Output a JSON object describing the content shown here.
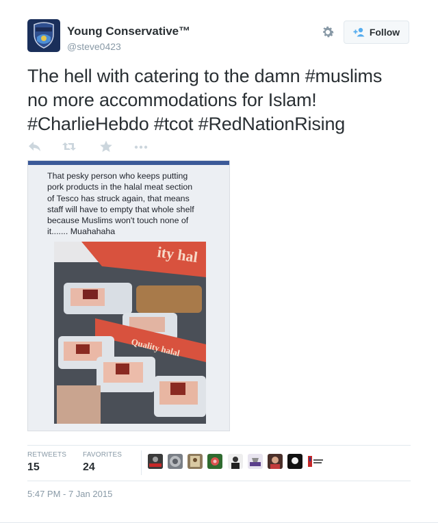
{
  "author": {
    "name": "Young Conservative™",
    "handle": "@steve0423",
    "avatar_badge_text": "POLICE DEPARTMENT"
  },
  "header": {
    "settings_icon": "gear-icon",
    "follow_label": "Follow",
    "follow_icon": "add-user-icon"
  },
  "tweet": {
    "lines": [
      "The hell with catering to the damn #muslims",
      "no more accommodations for Islam!",
      "#CharlieHebdo #tcot #RedNationRising"
    ]
  },
  "actions": [
    "reply-icon",
    "retweet-icon",
    "favorite-star-icon",
    "more-icon"
  ],
  "media": {
    "caption_lines": [
      "That pesky person who keeps putting",
      "pork products in the halal meat section",
      "of Tesco has struck again, that means",
      "staff will have to empty that whole shelf",
      "because Muslims won't touch none of",
      "it....... Muahahaha"
    ],
    "shelf_label_1": "ity hal",
    "shelf_label_2": "Quality halal"
  },
  "stats": {
    "retweets_label": "RETWEETS",
    "retweets_value": "15",
    "favorites_label": "FAVORITES",
    "favorites_value": "24"
  },
  "favoriters_count_shown": 10,
  "timestamp": "5:47 PM - 7 Jan 2015",
  "colors": {
    "text": "#292f33",
    "muted": "#8899a6",
    "border": "#e1e8ed",
    "follow_icon": "#55acee",
    "action_icon": "#ccd6dd"
  }
}
